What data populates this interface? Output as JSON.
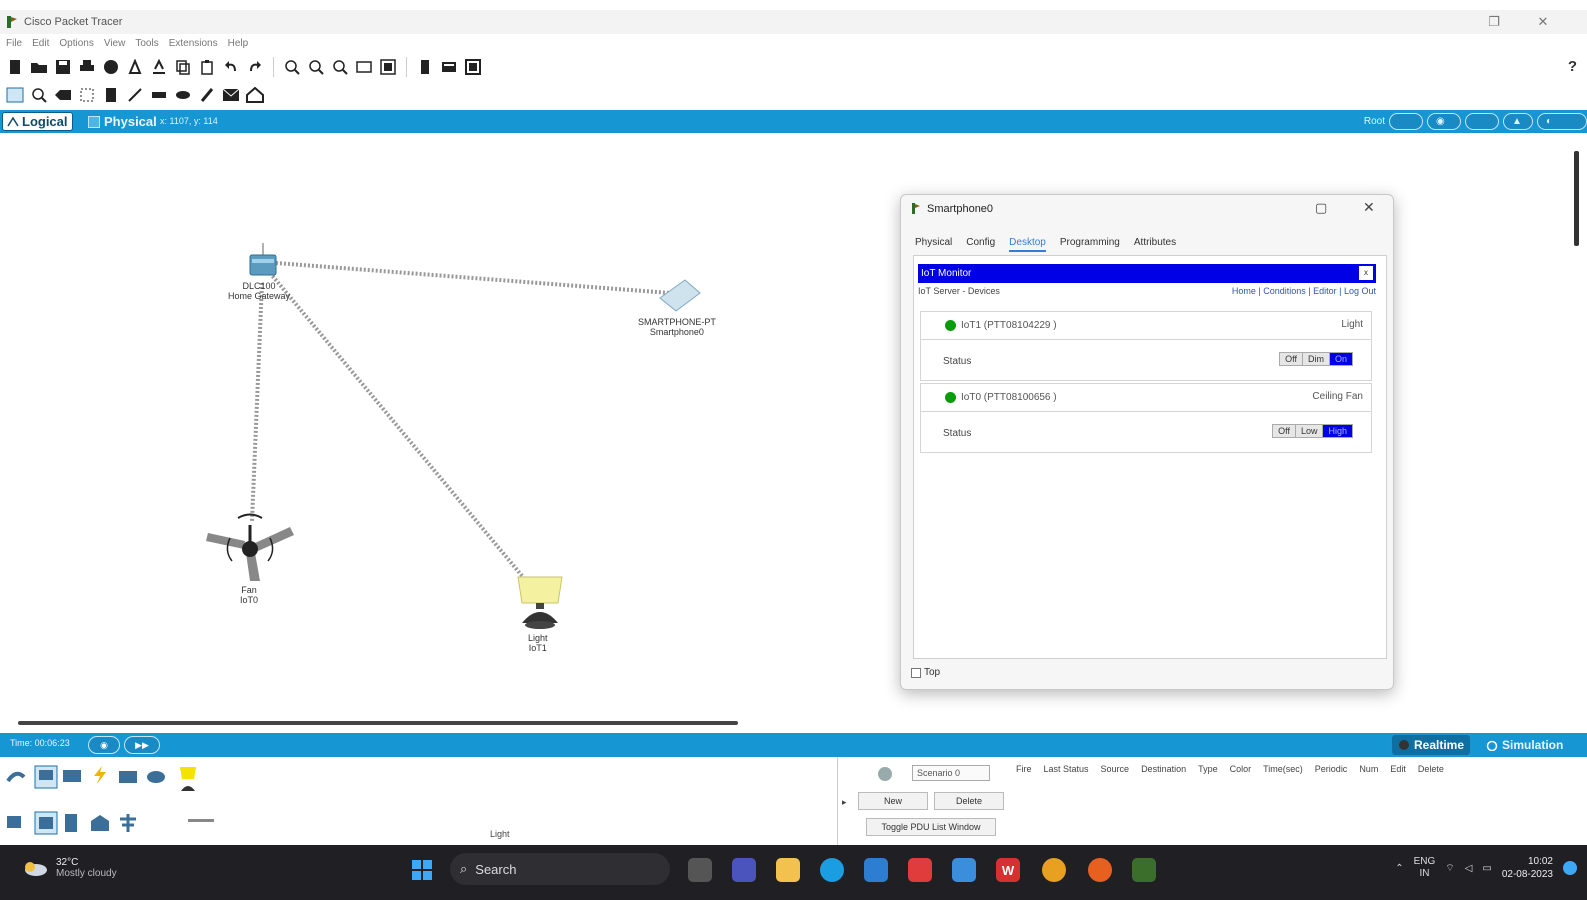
{
  "window": {
    "title": "Cisco Packet Tracer",
    "restore_glyph": "❐",
    "close_glyph": "✕"
  },
  "menu": [
    "File",
    "Edit",
    "Options",
    "View",
    "Tools",
    "Extensions",
    "Help"
  ],
  "help_label": "?",
  "workspace_tabs": {
    "logical": "Logical",
    "physical": "Physical",
    "coords": "x: 1107, y: 114",
    "root_label": "Root"
  },
  "devices": {
    "gateway": {
      "name": "DLC100",
      "type": "Home Gateway"
    },
    "smartphone": {
      "name": "SMARTPHONE-PT",
      "type": "Smartphone0"
    },
    "fan": {
      "name": "Fan",
      "sub": "IoT0"
    },
    "light": {
      "name": "Light",
      "sub": "IoT1"
    }
  },
  "dialog": {
    "title": "Smartphone0",
    "tabs": [
      "Physical",
      "Config",
      "Desktop",
      "Programming",
      "Attributes"
    ],
    "active_tab": "Desktop",
    "iot_header": "IoT Monitor",
    "iot_header_btn": "x",
    "server_line": "IoT Server - Devices",
    "links": "Home | Conditions | Editor | Log Out",
    "iot_devices": [
      {
        "name": "IoT1 (PTT08104229 )",
        "type": "Light",
        "status_label": "Status",
        "options": [
          "Off",
          "Dim",
          "On"
        ],
        "selected": "On"
      },
      {
        "name": "IoT0 (PTT08100656 )",
        "type": "Ceiling Fan",
        "status_label": "Status",
        "options": [
          "Off",
          "Low",
          "High"
        ],
        "selected": "High"
      }
    ],
    "top_checkbox_label": "Top"
  },
  "statusbar": {
    "time": "Time: 00:06:23",
    "realtime": "Realtime",
    "simulation": "Simulation"
  },
  "device_panel": {
    "selected_type": "Light"
  },
  "pdu": {
    "scenario": "Scenario 0",
    "new_label": "New",
    "delete_label": "Delete",
    "toggle_label": "Toggle PDU List Window",
    "columns": [
      "Fire",
      "Last Status",
      "Source",
      "Destination",
      "Type",
      "Color",
      "Time(sec)",
      "Periodic",
      "Num",
      "Edit",
      "Delete"
    ]
  },
  "taskbar": {
    "temp": "32°C",
    "condition": "Mostly cloudy",
    "search": "Search",
    "lang": "ENG",
    "region": "IN",
    "time": "10:02",
    "date": "02-08-2023"
  },
  "colors": {
    "accent_blue": "#1697d4",
    "iot_header": "#0000e6",
    "led_green": "#0a9b0a"
  }
}
